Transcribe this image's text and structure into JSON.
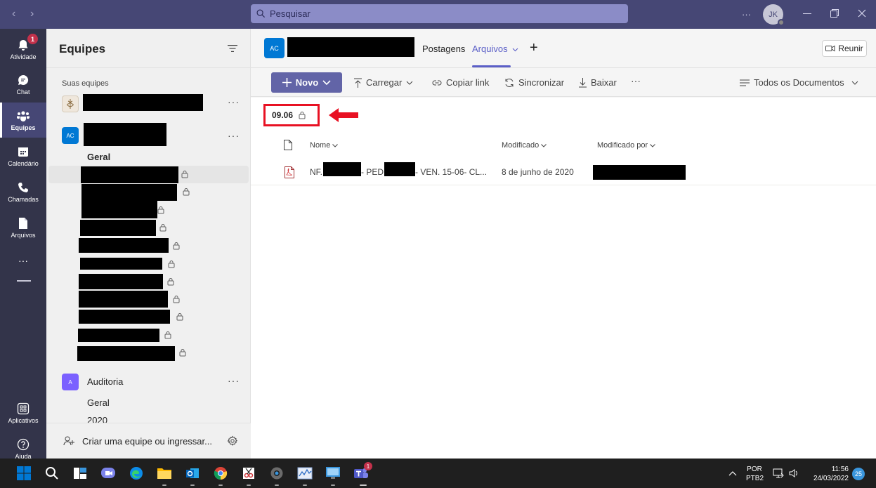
{
  "titlebar": {
    "search_placeholder": "Pesquisar",
    "more_label": "···",
    "avatar_initials": "JK"
  },
  "rail": {
    "items": [
      {
        "label": "Atividade",
        "icon": "bell-icon",
        "badge": "1"
      },
      {
        "label": "Chat",
        "icon": "chat-icon"
      },
      {
        "label": "Equipes",
        "icon": "teams-icon",
        "active": true
      },
      {
        "label": "Calendário",
        "icon": "calendar-icon"
      },
      {
        "label": "Chamadas",
        "icon": "phone-icon"
      },
      {
        "label": "Arquivos",
        "icon": "file-icon"
      },
      {
        "label": "···",
        "icon": "more-icon"
      }
    ],
    "bottom": [
      {
        "label": "Aplicativos",
        "icon": "apps-icon"
      },
      {
        "label": "Ajuda",
        "icon": "help-icon"
      }
    ]
  },
  "teams_pane": {
    "title": "Equipes",
    "section_label": "Suas equipes",
    "team2_initials": "AC",
    "general_channel": "Geral",
    "team3": {
      "initial": "A",
      "name": "Auditoria",
      "channels": [
        "Geral",
        "2020"
      ]
    },
    "create_label": "Criar uma equipe ou ingressar...",
    "more": "···"
  },
  "main": {
    "avatar_initials": "AC",
    "tabs": [
      {
        "label": "Postagens"
      },
      {
        "label": "Arquivos",
        "active": true
      }
    ],
    "add_tab": "+",
    "meet_label": "Reunir",
    "commands": {
      "new_label": "Novo",
      "upload_label": "Carregar",
      "copy_link_label": "Copiar link",
      "sync_label": "Sincronizar",
      "download_label": "Baixar",
      "more_label": "···",
      "view_label": "Todos os Documentos"
    },
    "breadcrumb_folder": "09.06",
    "columns": {
      "name": "Nome",
      "modified": "Modificado",
      "modified_by": "Modificado por"
    },
    "files": [
      {
        "name_parts": [
          "NF.",
          "- PED.",
          "- VEN. 15-06- CL..."
        ],
        "modified": "8 de junho de 2020"
      }
    ]
  },
  "taskbar": {
    "lang_line1": "POR",
    "lang_line2": "PTB2",
    "time": "11:56",
    "date": "24/03/2022",
    "notif_count": "25",
    "teams_badge": "1"
  },
  "colors": {
    "brand": "#464775",
    "accent": "#6264a7",
    "active_tab": "#5b5fc7",
    "annotation_red": "#e81123"
  }
}
